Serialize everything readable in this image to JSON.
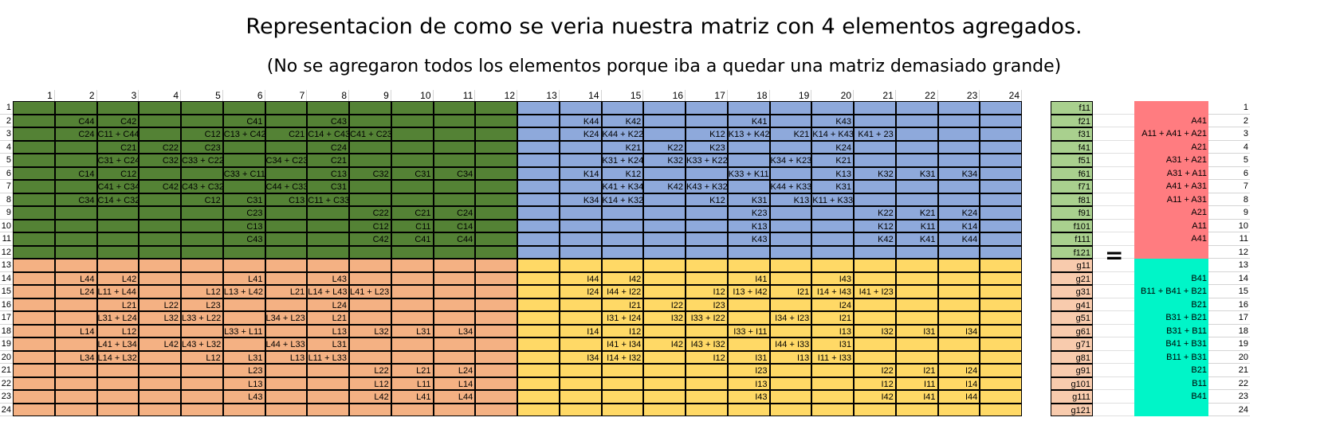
{
  "title": "Representacion de como se veria nuestra matriz con 4 elementos agregados.",
  "subtitle": "(No se agregaron todos los elementos porque iba a quedar una matriz demasiado grande)",
  "equals": "=",
  "colors": {
    "green": "#548235",
    "blue": "#8EA9DB",
    "orange": "#F4B183",
    "yellow": "#FFD966",
    "f_column": "#A9D08E",
    "g_column": "#F8CBAD",
    "a_column": "#FF7C80",
    "b_column": "#00F5C8"
  },
  "column_headers": [
    "1",
    "2",
    "3",
    "4",
    "5",
    "6",
    "7",
    "8",
    "9",
    "10",
    "11",
    "12",
    "13",
    "14",
    "15",
    "16",
    "17",
    "18",
    "19",
    "20",
    "21",
    "22",
    "23",
    "24"
  ],
  "row_numbers": [
    "1",
    "2",
    "3",
    "4",
    "5",
    "6",
    "7",
    "8",
    "9",
    "10",
    "11",
    "12",
    "13",
    "14",
    "15",
    "16",
    "17",
    "18",
    "19",
    "20",
    "21",
    "22",
    "23",
    "24"
  ],
  "matrix_rows": [
    [
      "",
      "",
      "",
      "",
      "",
      "",
      "",
      "",
      "",
      "",
      "",
      "",
      "",
      "",
      "",
      "",
      "",
      "",
      "",
      "",
      "",
      "",
      "",
      ""
    ],
    [
      "",
      "C44",
      "C42",
      "",
      "",
      "C41",
      "",
      "C43",
      "",
      "",
      "",
      "",
      "",
      "K44",
      "K42",
      "",
      "",
      "K41",
      "",
      "K43",
      "",
      "",
      "",
      ""
    ],
    [
      "",
      "C24",
      "C11 + C44 + C22",
      "",
      "C12",
      "C13 + C42",
      "C21",
      "C14 + C43",
      "C41 + C23",
      "",
      "",
      "",
      "",
      "K24",
      "K44 + K22",
      "",
      "K12",
      "K13 + K42",
      "K21",
      "K14 + K43",
      "K41 + 23",
      "",
      "",
      ""
    ],
    [
      "",
      "",
      "C21",
      "C22",
      "C23",
      "",
      "",
      "C24",
      "",
      "",
      "",
      "",
      "",
      "",
      "K21",
      "K22",
      "K23",
      "",
      "",
      "K24",
      "",
      "",
      "",
      ""
    ],
    [
      "",
      "",
      "C31 + C24",
      "C32",
      "C33 + C22",
      "",
      "C34 + C23",
      "C21",
      "",
      "",
      "",
      "",
      "",
      "",
      "K31 + K24",
      "K32",
      "K33 + K22",
      "",
      "K34 + K23",
      "K21",
      "",
      "",
      "",
      ""
    ],
    [
      "",
      "C14",
      "C12",
      "",
      "",
      "C33 + C11",
      "",
      "C13",
      "C32",
      "C31",
      "C34",
      "",
      "",
      "K14",
      "K12",
      "",
      "",
      "K33 + K11",
      "",
      "K13",
      "K32",
      "K31",
      "K34",
      ""
    ],
    [
      "",
      "",
      "C41 + C34",
      "C42",
      "C43 + C32",
      "",
      "C44 + C33",
      "C31",
      "",
      "",
      "",
      "",
      "",
      "",
      "K41 + K34",
      "K42",
      "K43 + K32",
      "",
      "K44 + K33",
      "K31",
      "",
      "",
      "",
      ""
    ],
    [
      "",
      "C34",
      "C14 + C32",
      "",
      "C12",
      "C31",
      "C13",
      "C11 + C33",
      "",
      "",
      "",
      "",
      "",
      "K34",
      "K14 + K32",
      "",
      "K12",
      "K31",
      "K13",
      "K11 + K33",
      "",
      "",
      "",
      ""
    ],
    [
      "",
      "",
      "",
      "",
      "",
      "C23",
      "",
      "",
      "C22",
      "C21",
      "C24",
      "",
      "",
      "",
      "",
      "",
      "",
      "K23",
      "",
      "",
      "K22",
      "K21",
      "K24",
      ""
    ],
    [
      "",
      "",
      "",
      "",
      "",
      "C13",
      "",
      "",
      "C12",
      "C11",
      "C14",
      "",
      "",
      "",
      "",
      "",
      "",
      "K13",
      "",
      "",
      "K12",
      "K11",
      "K14",
      ""
    ],
    [
      "",
      "",
      "",
      "",
      "",
      "C43",
      "",
      "",
      "C42",
      "C41",
      "C44",
      "",
      "",
      "",
      "",
      "",
      "",
      "K43",
      "",
      "",
      "K42",
      "K41",
      "K44",
      ""
    ],
    [
      "",
      "",
      "",
      "",
      "",
      "",
      "",
      "",
      "",
      "",
      "",
      "",
      "",
      "",
      "",
      "",
      "",
      "",
      "",
      "",
      "",
      "",
      "",
      ""
    ],
    [
      "",
      "",
      "",
      "",
      "",
      "",
      "",
      "",
      "",
      "",
      "",
      "",
      "",
      "",
      "",
      "",
      "",
      "",
      "",
      "",
      "",
      "",
      "",
      ""
    ],
    [
      "",
      "L44",
      "L42",
      "",
      "",
      "L41",
      "",
      "L43",
      "",
      "",
      "",
      "",
      "",
      "I44",
      "I42",
      "",
      "",
      "I41",
      "",
      "I43",
      "",
      "",
      "",
      ""
    ],
    [
      "",
      "L24",
      "L11 + L44 + L22",
      "",
      "L12",
      "L13 + L42",
      "L21",
      "L14 + L43",
      "L41 + L23",
      "",
      "",
      "",
      "",
      "I24",
      "I44 + I22",
      "",
      "I12",
      "I13 + I42",
      "I21",
      "I14 + I43",
      "I41 + I23",
      "",
      "",
      ""
    ],
    [
      "",
      "",
      "L21",
      "L22",
      "L23",
      "",
      "",
      "L24",
      "",
      "",
      "",
      "",
      "",
      "",
      "I21",
      "I22",
      "I23",
      "",
      "",
      "I24",
      "",
      "",
      "",
      ""
    ],
    [
      "",
      "",
      "L31 + L24",
      "L32",
      "L33 + L22",
      "",
      "L34 + L23",
      "L21",
      "",
      "",
      "",
      "",
      "",
      "",
      "I31 + I24",
      "I32",
      "I33 + I22",
      "",
      "I34 + I23",
      "I21",
      "",
      "",
      "",
      ""
    ],
    [
      "",
      "L14",
      "L12",
      "",
      "",
      "L33 + L11",
      "",
      "L13",
      "L32",
      "L31",
      "L34",
      "",
      "",
      "I14",
      "I12",
      "",
      "",
      "I33 + I11",
      "",
      "I13",
      "I32",
      "I31",
      "I34",
      ""
    ],
    [
      "",
      "",
      "L41 + L34",
      "L42",
      "L43 + L32",
      "",
      "L44 + L33",
      "L31",
      "",
      "",
      "",
      "",
      "",
      "",
      "I41 + I34",
      "I42",
      "I43 + I32",
      "",
      "I44 + I33",
      "I31",
      "",
      "",
      "",
      ""
    ],
    [
      "",
      "L34",
      "L14 + L32",
      "",
      "L12",
      "L31",
      "L13",
      "L11 + L33",
      "",
      "",
      "",
      "",
      "",
      "I34",
      "I14 + I32",
      "",
      "I12",
      "I31",
      "I13",
      "I11 + I33",
      "",
      "",
      "",
      ""
    ],
    [
      "",
      "",
      "",
      "",
      "",
      "L23",
      "",
      "",
      "L22",
      "L21",
      "L24",
      "",
      "",
      "",
      "",
      "",
      "",
      "I23",
      "",
      "",
      "I22",
      "I21",
      "I24",
      ""
    ],
    [
      "",
      "",
      "",
      "",
      "",
      "L13",
      "",
      "",
      "L12",
      "L11",
      "L14",
      "",
      "",
      "",
      "",
      "",
      "",
      "I13",
      "",
      "",
      "I12",
      "I11",
      "I14",
      ""
    ],
    [
      "",
      "",
      "",
      "",
      "",
      "L43",
      "",
      "",
      "L42",
      "L41",
      "L44",
      "",
      "",
      "",
      "",
      "",
      "",
      "I43",
      "",
      "",
      "I42",
      "I41",
      "I44",
      ""
    ],
    [
      "",
      "",
      "",
      "",
      "",
      "",
      "",
      "",
      "",
      "",
      "",
      "",
      "",
      "",
      "",
      "",
      "",
      "",
      "",
      "",
      "",
      "",
      "",
      ""
    ]
  ],
  "vector_x": [
    "f11",
    "f21",
    "f31",
    "f41",
    "f51",
    "f61",
    "f71",
    "f81",
    "f91",
    "f101",
    "f111",
    "f121",
    "g11",
    "g21",
    "g31",
    "g41",
    "g51",
    "g61",
    "g71",
    "g81",
    "g91",
    "g101",
    "g111",
    "g121"
  ],
  "vector_b": [
    "",
    "A41",
    "A11 + A41 + A21",
    "A21",
    "A31 + A21",
    "A31 + A11",
    "A41 + A31",
    "A11 + A31",
    "A21",
    "A11",
    "A41",
    "",
    "",
    "B41",
    "B11 + B41 + B21",
    "B21",
    "B31 + B21",
    "B31 + B11",
    "B41 + B31",
    "B11 + B31",
    "B21",
    "B11",
    "B41",
    ""
  ]
}
